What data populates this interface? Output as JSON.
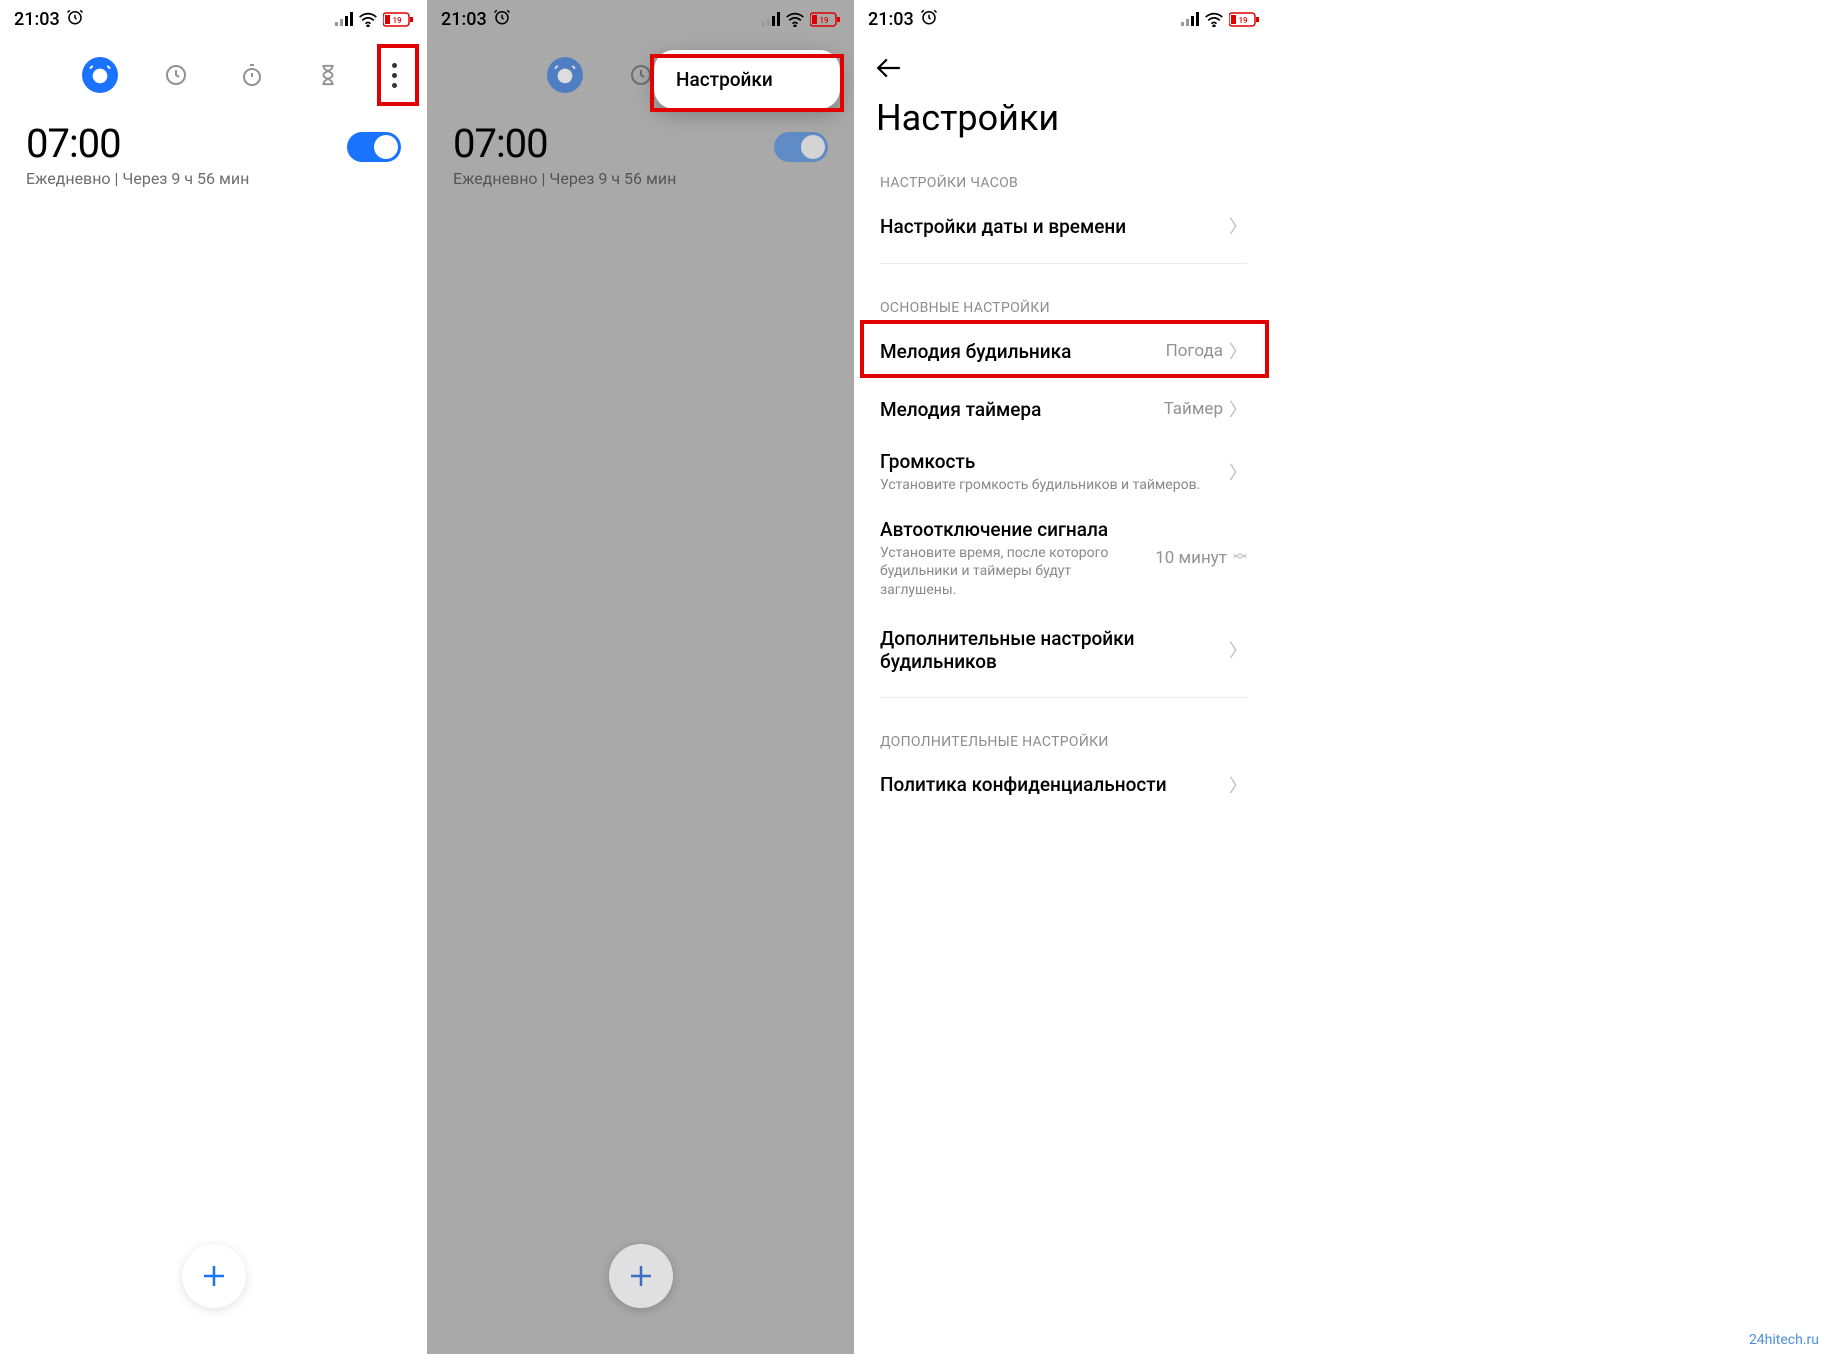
{
  "status": {
    "time": "21:03",
    "battery": "19"
  },
  "alarm": {
    "time": "07:00",
    "sub_repeat": "Ежедневно",
    "sub_sep": " | ",
    "sub_remaining": "Через 9 ч 56 мин"
  },
  "popup": {
    "settings": "Настройки"
  },
  "settings": {
    "title": "Настройки",
    "section_clock": "НАСТРОЙКИ ЧАСОВ",
    "datetime": "Настройки даты и времени",
    "section_main": "ОСНОВНЫЕ НАСТРОЙКИ",
    "alarm_melody": {
      "label": "Мелодия будильника",
      "value": "Погода"
    },
    "timer_melody": {
      "label": "Мелодия таймера",
      "value": "Таймер"
    },
    "volume": {
      "label": "Громкость",
      "desc": "Установите громкость будильников и таймеров."
    },
    "autooff": {
      "label": "Автоотключение сигнала",
      "desc": "Установите время, после которого будильники и таймеры будут заглушены.",
      "value": "10 минут"
    },
    "extra_alarm": "Дополнительные настройки будильников",
    "section_extra": "ДОПОЛНИТЕЛЬНЫЕ НАСТРОЙКИ",
    "privacy": "Политика конфиденциальности"
  },
  "watermark": "24hitech.ru"
}
